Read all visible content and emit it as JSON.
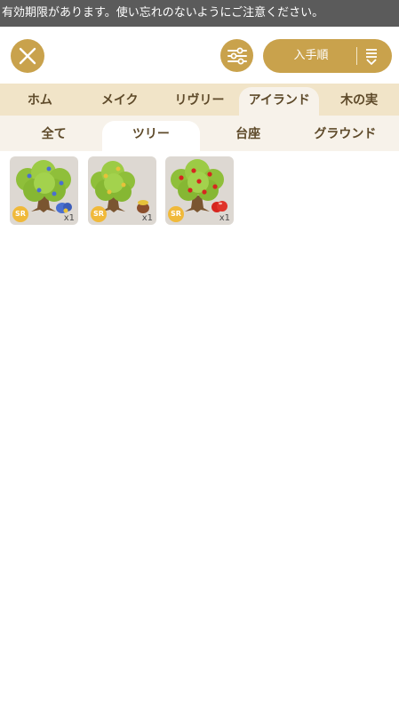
{
  "banner": {
    "text": "有効期限があります。使い忘れのないようにご注意ください。"
  },
  "header": {
    "close_icon": "close-icon",
    "filter_icon": "filter-sliders-icon",
    "sort": {
      "label": "入手順",
      "icon": "sort-descending-icon"
    }
  },
  "category_tabs": [
    "ホム",
    "メイク",
    "リヴリー",
    "アイランド",
    "木の実"
  ],
  "active_category": "アイランド",
  "sub_tabs": [
    "全て",
    "ツリー",
    "台座",
    "グラウンド"
  ],
  "active_sub_tab": "ツリー",
  "items": [
    {
      "rarity": "SR",
      "quantity": "x1",
      "fruit": "blue-berry",
      "fruit_color": "#4a6fd0",
      "foliage": "#8fbf3a"
    },
    {
      "rarity": "SR",
      "quantity": "x1",
      "fruit": "chestnut",
      "fruit_color": "#e6c23a",
      "foliage": "#8fbf3a"
    },
    {
      "rarity": "SR",
      "quantity": "x1",
      "fruit": "red-apple",
      "fruit_color": "#d6261f",
      "foliage": "#8fbf3a"
    }
  ],
  "colors": {
    "accent": "#c9a24c",
    "tab_bar": "#f1e4c8",
    "sub_tab_bar": "#f7f2ea",
    "text": "#5e4a2a"
  }
}
